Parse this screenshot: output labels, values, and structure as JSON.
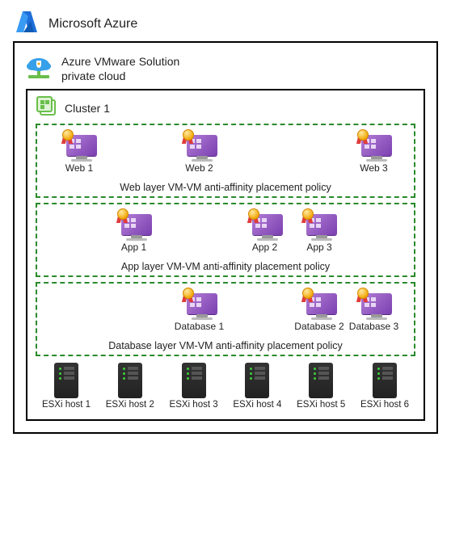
{
  "header": {
    "title": "Microsoft Azure"
  },
  "avs": {
    "line1": "Azure VMware Solution",
    "line2": "private cloud"
  },
  "cluster": {
    "title": "Cluster 1",
    "policies": [
      {
        "caption": "Web layer VM-VM anti-affinity placement policy",
        "vms": [
          {
            "label": "Web 1",
            "pos": 0
          },
          {
            "label": "Web 2",
            "pos": 2
          },
          {
            "label": "Web 3",
            "pos": 5
          }
        ]
      },
      {
        "caption": "App layer VM-VM anti-affinity placement policy",
        "vms": [
          {
            "label": "App 1",
            "pos": 1
          },
          {
            "label": "App 2",
            "pos": 3
          },
          {
            "label": "App 3",
            "pos": 4
          }
        ]
      },
      {
        "caption": "Database layer VM-VM anti-affinity placement policy",
        "vms": [
          {
            "label": "Database 1",
            "pos": 2
          },
          {
            "label": "Database 2",
            "pos": 4
          },
          {
            "label": "Database 3",
            "pos": 5
          }
        ]
      }
    ],
    "hosts": [
      {
        "label": "ESXi host 1"
      },
      {
        "label": "ESXi host 2"
      },
      {
        "label": "ESXi host 3"
      },
      {
        "label": "ESXi host 4"
      },
      {
        "label": "ESXi host 5"
      },
      {
        "label": "ESXi host 6"
      }
    ]
  },
  "layout": {
    "positions_pct": [
      2,
      17,
      35,
      53,
      68,
      83
    ]
  }
}
